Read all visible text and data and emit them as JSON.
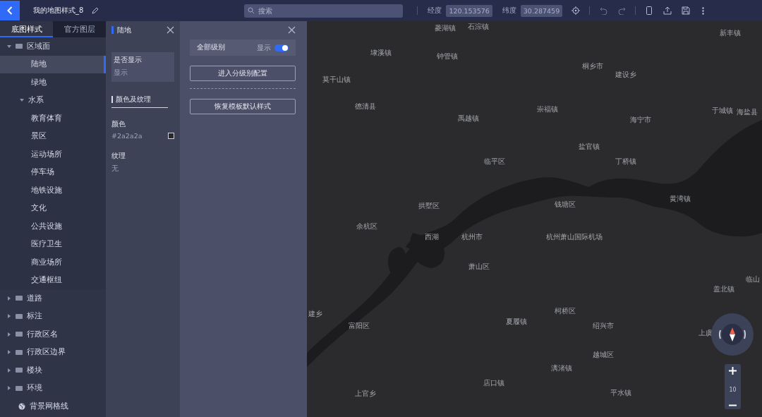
{
  "topbar": {
    "title": "我的地图样式_8",
    "search": {
      "placeholder": "搜索"
    },
    "longitude": {
      "label": "经度",
      "value": "120.153576"
    },
    "latitude": {
      "label": "纬度",
      "value": "30.287459"
    }
  },
  "sidebar": {
    "tabs": [
      {
        "label": "底图样式",
        "selected": true
      },
      {
        "label": "官方图层",
        "selected": false
      }
    ],
    "tree": [
      {
        "label": "区域面",
        "kind": "folder",
        "expanded": true,
        "children": [
          {
            "label": "陆地",
            "kind": "leaf",
            "selected": true
          },
          {
            "label": "绿地",
            "kind": "leaf",
            "selected": false
          },
          {
            "label": "水系",
            "kind": "group",
            "expanded": true,
            "selected": false
          },
          {
            "label": "教育体育",
            "kind": "leaf",
            "selected": false
          },
          {
            "label": "景区",
            "kind": "leaf",
            "selected": false
          },
          {
            "label": "运动场所",
            "kind": "leaf",
            "selected": false
          },
          {
            "label": "停车场",
            "kind": "leaf",
            "selected": false
          },
          {
            "label": "地铁设施",
            "kind": "leaf",
            "selected": false
          },
          {
            "label": "文化",
            "kind": "leaf",
            "selected": false
          },
          {
            "label": "公共设施",
            "kind": "leaf",
            "selected": false
          },
          {
            "label": "医疗卫生",
            "kind": "leaf",
            "selected": false
          },
          {
            "label": "商业场所",
            "kind": "leaf",
            "selected": false
          },
          {
            "label": "交通枢纽",
            "kind": "leaf",
            "selected": false
          }
        ]
      },
      {
        "label": "道路",
        "kind": "folder",
        "expanded": false
      },
      {
        "label": "标注",
        "kind": "folder",
        "expanded": false
      },
      {
        "label": "行政区名",
        "kind": "folder",
        "expanded": false
      },
      {
        "label": "行政区边界",
        "kind": "folder",
        "expanded": false
      },
      {
        "label": "楼块",
        "kind": "folder",
        "expanded": false
      },
      {
        "label": "环境",
        "kind": "folder",
        "expanded": false
      },
      {
        "label": "背景网格线",
        "kind": "globe"
      }
    ]
  },
  "style_panel": {
    "title": "陆地",
    "visibility": {
      "label": "是否显示",
      "value": "显示"
    },
    "section": "颜色及纹理",
    "color": {
      "label": "颜色",
      "value": "#2a2a2a"
    },
    "texture": {
      "label": "纹理",
      "value": "无"
    }
  },
  "level_panel": {
    "all_levels": {
      "label": "全部级别",
      "state_label": "显示",
      "on": true
    },
    "buttons": [
      "进入分级别配置",
      "恢复模板默认样式"
    ]
  },
  "map": {
    "places": [
      "菱湖镇",
      "石淙镇",
      "新丰镇",
      "埭溪镇",
      "钟管镇",
      "桐乡市",
      "建设乡",
      "莫干山镇",
      "德清县",
      "禹越镇",
      "崇福镇",
      "海宁市",
      "于城镇",
      "海盐县",
      "盐官镇",
      "临平区",
      "丁桥镇",
      "拱墅区",
      "钱塘区",
      "黄湾镇",
      "余杭区",
      "西湖",
      "杭州市",
      "杭州萧山国际机场",
      "萧山区",
      "临山",
      "盖北镇",
      "建乡",
      "柯桥区",
      "富阳区",
      "夏履镇",
      "绍兴市",
      "上虞",
      "越城区",
      "漓渚镇",
      "店口镇",
      "上官乡",
      "平水镇"
    ],
    "zoom_level": "10"
  }
}
